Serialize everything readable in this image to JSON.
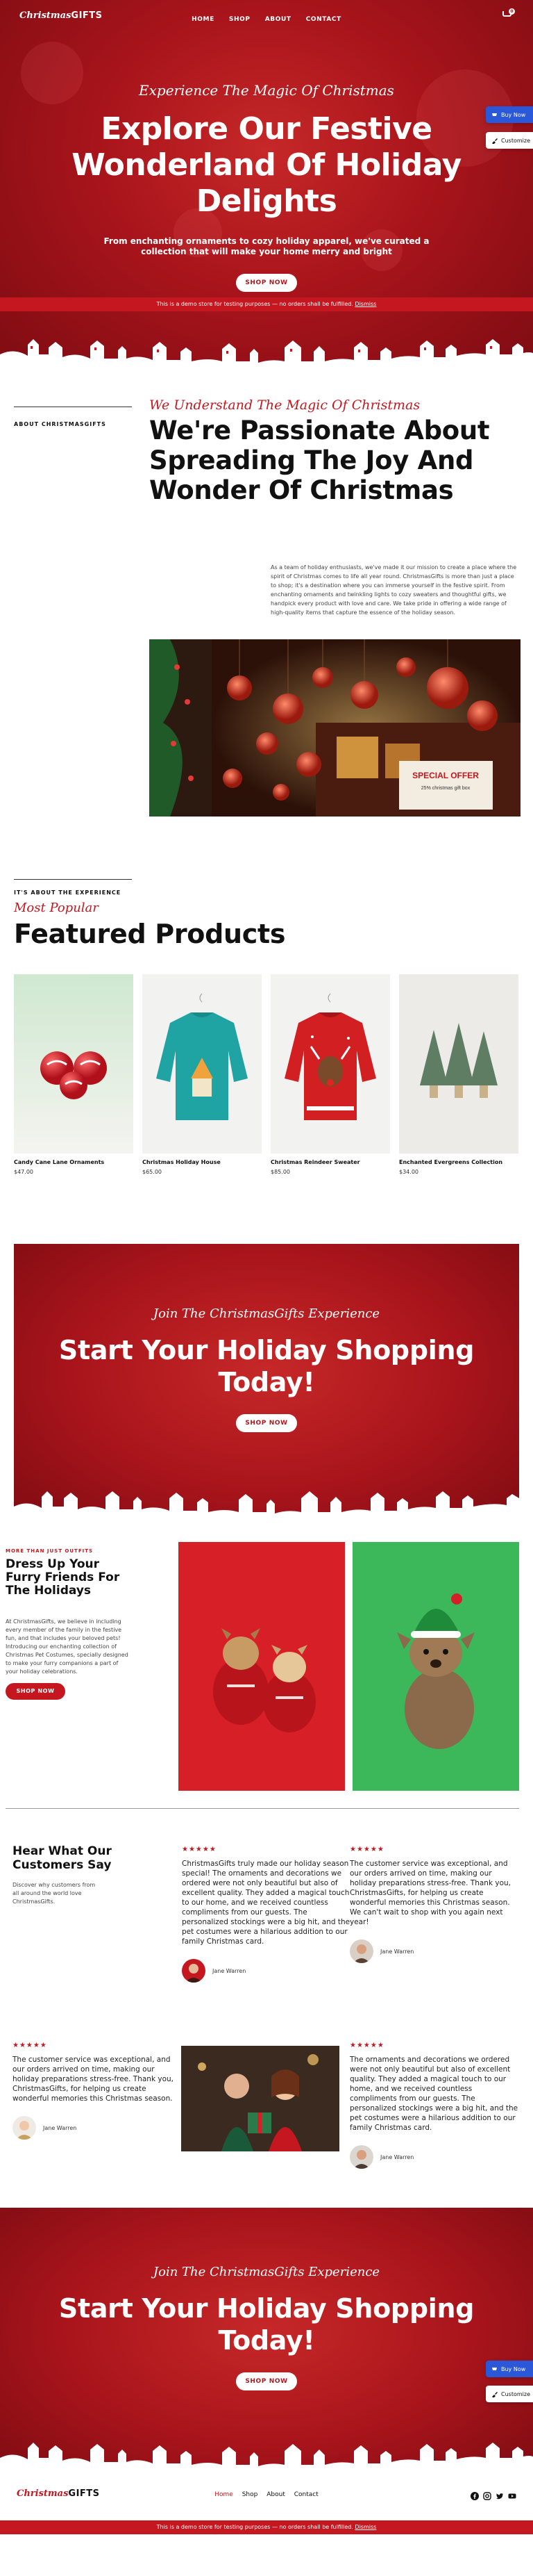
{
  "nav": {
    "logo_script": "Christmas",
    "logo_bold": "GIFTS",
    "links": [
      "HOME",
      "SHOP",
      "ABOUT",
      "CONTACT"
    ],
    "cart_count": "0"
  },
  "hero": {
    "script": "Experience The Magic Of Christmas",
    "title": "Explore Our Festive Wonderland Of Holiday Delights",
    "desc": "From enchanting ornaments to cozy holiday apparel, we've curated a collection that will make your home merry and bright",
    "button": "SHOP NOW"
  },
  "demo_bar": {
    "text": "This is a demo store for testing purposes — no orders shall be fulfilled.",
    "dismiss": "Dismiss"
  },
  "floating": {
    "buy_now": "Buy Now",
    "customize": "Customize"
  },
  "about": {
    "kicker": "ABOUT CHRISTMASGIFTS",
    "script": "We Understand The Magic Of Christmas",
    "title": "We're Passionate About Spreading The Joy And Wonder Of Christmas",
    "body": "As a team of holiday enthusiasts, we've made it our mission to create a place where the spirit of Christmas comes to life all year round. ChristmasGifts is more than just a place to shop; it's a destination where you can immerse yourself in the festive spirit. From enchanting ornaments and twinkling lights to cozy sweaters and thoughtful gifts, we handpick every product with love and care. We take pride in offering a wide range of high-quality items that capture the essence of the holiday season.",
    "sign_text": "SPECIAL OFFER",
    "sign_sub": "25% christmas gift box"
  },
  "products": {
    "kicker": "IT'S ABOUT THE EXPERIENCE",
    "script": "Most Popular",
    "title": "Featured Products",
    "items": [
      {
        "name": "Candy Cane Lane Ornaments",
        "price": "$47.00"
      },
      {
        "name": "Christmas Holiday House",
        "price": "$65.00"
      },
      {
        "name": "Christmas Reindeer Sweater",
        "price": "$85.00"
      },
      {
        "name": "Enchanted Evergreens Collection",
        "price": "$34.00"
      }
    ]
  },
  "cta1": {
    "script": "Join The ChristmasGifts Experience",
    "title": "Start Your Holiday Shopping Today!",
    "button": "SHOP NOW"
  },
  "pet": {
    "kicker": "MORE THAN JUST OUTFITS",
    "title": "Dress Up Your Furry Friends For The Holidays",
    "body": "At ChristmasGifts, we believe in including every member of the family in the festive fun, and that includes your beloved pets! Introducing our enchanting collection of Christmas Pet Costumes, specially designed to make your furry companions a part of your holiday celebrations.",
    "button": "SHOP NOW"
  },
  "testimonials": {
    "title": "Hear What Our Customers Say",
    "lead": "Discover why customers from all around the world love ChristmasGifts.",
    "stars": "★★★★★",
    "items": [
      {
        "quote": "ChristmasGifts truly made our holiday season special! The ornaments and decorations we ordered were not only beautiful but also of excellent quality. They added a magical touch to our home, and we received countless compliments from our guests. The personalized stockings were a big hit, and the pet costumes were a hilarious addition to our family Christmas card.",
        "author": "Jane Warren"
      },
      {
        "quote": "The customer service was exceptional, and our orders arrived on time, making our holiday preparations stress-free. Thank you, ChristmasGifts, for helping us create wonderful memories this Christmas season. We can't wait to shop with you again next year!",
        "author": "Jane Warren"
      },
      {
        "quote": "The customer service was exceptional, and our orders arrived on time, making our holiday preparations stress-free. Thank you, ChristmasGifts, for helping us create wonderful memories this Christmas season.",
        "author": "Jane Warren"
      },
      {
        "quote": "The ornaments and decorations we ordered were not only beautiful but also of excellent quality. They added a magical touch to our home, and we received countless compliments from our guests. The personalized stockings were a big hit, and the pet costumes were a hilarious addition to our family Christmas card.",
        "author": "Jane Warren"
      }
    ]
  },
  "cta2": {
    "script": "Join The ChristmasGifts Experience",
    "title": "Start Your Holiday Shopping Today!",
    "button": "SHOP NOW"
  },
  "footer": {
    "logo_script": "Christmas",
    "logo_bold": "GIFTS",
    "links": [
      "Home",
      "Shop",
      "About",
      "Contact"
    ]
  },
  "colors": {
    "brand_red": "#c4171f",
    "dark_red": "#7d0c12",
    "buy_blue": "#2b57d9"
  },
  "icons": [
    "cart-icon",
    "facebook-icon",
    "instagram-icon",
    "twitter-icon",
    "youtube-icon",
    "star-icon"
  ]
}
